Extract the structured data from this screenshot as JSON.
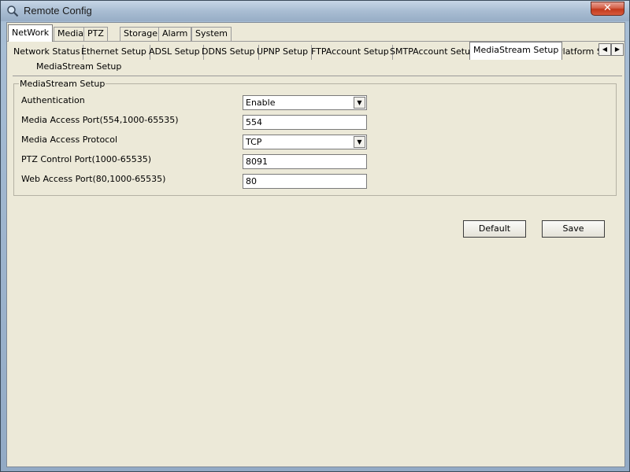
{
  "window": {
    "title": "Remote Config",
    "close_label": "✕"
  },
  "main_tabs": [
    {
      "label": "NetWork",
      "active": true
    },
    {
      "label": "Media"
    },
    {
      "label": "PTZ"
    },
    {
      "label": "Storage"
    },
    {
      "label": "Alarm"
    },
    {
      "label": "System"
    }
  ],
  "sub_tabs": [
    {
      "label": "Network Status"
    },
    {
      "label": "Ethernet Setup"
    },
    {
      "label": "ADSL Setup"
    },
    {
      "label": "DDNS Setup"
    },
    {
      "label": "UPNP Setup"
    },
    {
      "label": "FTPAccount Setup"
    },
    {
      "label": "SMTPAccount Setup"
    },
    {
      "label": "MediaStream Setup",
      "active": true
    },
    {
      "label": "Platform Se"
    }
  ],
  "scroll": {
    "left": "◀",
    "right": "▶"
  },
  "page": {
    "heading": "MediaStream Setup",
    "group_title": "MediaStream Setup",
    "fields": [
      {
        "label": "Authentication",
        "value": "Enable",
        "type": "select"
      },
      {
        "label": "Media Access Port(554,1000-65535)",
        "value": "554",
        "type": "input"
      },
      {
        "label": "Media Access Protocol",
        "value": "TCP",
        "type": "select"
      },
      {
        "label": "PTZ Control Port(1000-65535)",
        "value": "8091",
        "type": "input"
      },
      {
        "label": "Web Access Port(80,1000-65535)",
        "value": "80",
        "type": "input"
      }
    ],
    "default_label": "Default",
    "save_label": "Save"
  },
  "icons": {
    "select_arrow": "▼",
    "app": "magnifier-icon"
  }
}
